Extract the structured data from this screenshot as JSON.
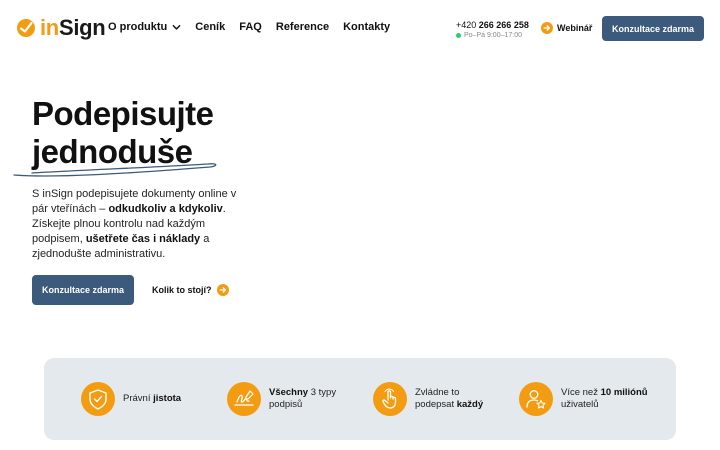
{
  "logo": {
    "text_prefix": "in",
    "text_suffix": "Sign"
  },
  "nav": {
    "items": [
      {
        "label": "O produktu",
        "has_dropdown": true
      },
      {
        "label": "Ceník"
      },
      {
        "label": "FAQ"
      },
      {
        "label": "Reference"
      },
      {
        "label": "Kontakty"
      }
    ]
  },
  "contact": {
    "phone_prefix": "+420 ",
    "phone_number": "266 266 258",
    "hours": "Po–Pá 9:00–17:00"
  },
  "header": {
    "webinar_label": "Webinář",
    "cta_label": "Konzultace zdarma"
  },
  "hero": {
    "title_line1": "Podepisujte",
    "title_line2": "jednoduše",
    "desc": {
      "p1": "S inSign podepisujete dokumenty online v pár vteřínách – ",
      "b1": "odkudkoliv a kdykoliv",
      "p2": ". Získejte plnou kontrolu nad každým podpisem, ",
      "b2": "ušetřete čas i náklady",
      "p3": " a zjednodušte administrativu."
    },
    "cta_label": "Konzultace zdarma",
    "price_link_label": "Kolik to stojí?"
  },
  "features": [
    {
      "icon": "shield-check-icon",
      "t1": "Právní ",
      "b": "jistota",
      "t2": ""
    },
    {
      "icon": "signature-icon",
      "t1": "",
      "b": "Všechny",
      "t2": " 3 typy podpisů"
    },
    {
      "icon": "hand-pointer-icon",
      "t1": "Zvládne to podepsat ",
      "b": "každý",
      "t2": ""
    },
    {
      "icon": "user-star-icon",
      "t1": "Více než ",
      "b": "10 miliónů",
      "t2": " uživatelů"
    }
  ],
  "colors": {
    "accent_orange": "#f39c12",
    "button_blue": "#3c5a7c",
    "strip_bg": "#e4e9ed",
    "status_green": "#2ecc71"
  }
}
